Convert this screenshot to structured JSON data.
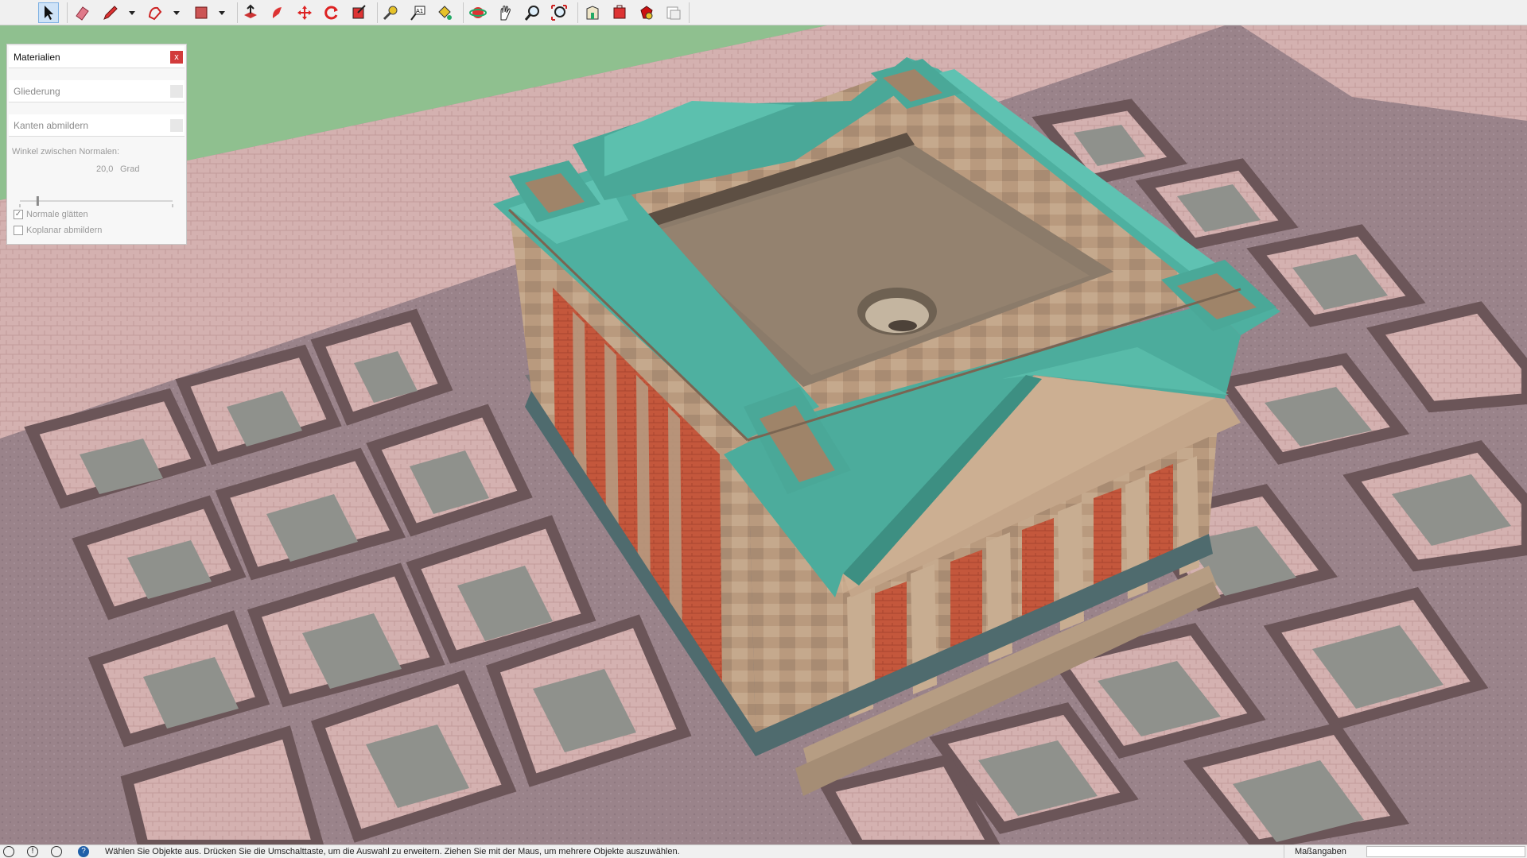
{
  "toolbar": {
    "tools": [
      {
        "id": "select",
        "icon": "select-arrow-icon"
      },
      {
        "id": "eraser",
        "icon": "eraser-icon"
      },
      {
        "id": "line",
        "icon": "pencil-icon"
      },
      {
        "id": "shapes",
        "icon": "shape-icon"
      },
      {
        "id": "rectangle",
        "icon": "rectangle-icon"
      },
      {
        "id": "push-pull",
        "icon": "push-pull-icon"
      },
      {
        "id": "follow-me",
        "icon": "follow-me-icon"
      },
      {
        "id": "move",
        "icon": "move-icon"
      },
      {
        "id": "rotate",
        "icon": "rotate-icon"
      },
      {
        "id": "scale",
        "icon": "scale-icon"
      },
      {
        "id": "tape-measure",
        "icon": "tape-measure-icon"
      },
      {
        "id": "text",
        "icon": "text-icon"
      },
      {
        "id": "paint",
        "icon": "paint-bucket-icon"
      },
      {
        "id": "orbit",
        "icon": "orbit-icon"
      },
      {
        "id": "pan",
        "icon": "pan-hand-icon"
      },
      {
        "id": "zoom",
        "icon": "zoom-icon"
      },
      {
        "id": "zoom-extents",
        "icon": "zoom-extents-icon"
      },
      {
        "id": "3d-warehouse",
        "icon": "warehouse-icon"
      },
      {
        "id": "extension-warehouse",
        "icon": "extension-icon"
      },
      {
        "id": "extension-manager",
        "icon": "ruby-icon"
      },
      {
        "id": "layout",
        "icon": "layout-icon"
      }
    ]
  },
  "panel": {
    "title": "Materialien",
    "close_label": "x",
    "section_outline": "Gliederung",
    "section_soften": "Kanten abmildern",
    "angle_label": "Winkel zwischen Normalen:",
    "angle_value": "20,0",
    "angle_unit": "Grad",
    "angle_fraction": 0.11,
    "smooth_normals_label": "Normale glätten",
    "smooth_normals_checked": true,
    "soften_coplanar_label": "Koplanar abmildern",
    "soften_coplanar_checked": false
  },
  "status": {
    "hint": "Wählen Sie Objekte aus. Drücken Sie die Umschalttaste, um die Auswahl zu erweitern. Ziehen Sie mit der Maus, um mehrere Objekte auszuwählen.",
    "measurements_label": "Maßangaben"
  },
  "colors": {
    "roof": "#4fb3a2",
    "stone": "#b89a7e",
    "brick": "#c4583c",
    "grass": "#8fc28f",
    "plaza": "#a28b92",
    "paving": "#d8b6b4"
  }
}
